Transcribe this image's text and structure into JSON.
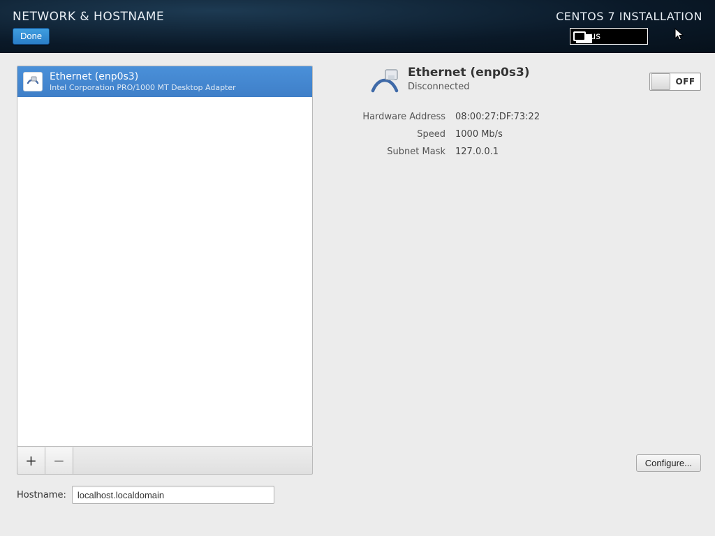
{
  "header": {
    "title": "NETWORK & HOSTNAME",
    "done": "Done",
    "right_title": "CENTOS 7 INSTALLATION",
    "keyboard_layout": "us"
  },
  "devices": [
    {
      "name": "Ethernet (enp0s3)",
      "adapter": "Intel Corporation PRO/1000 MT Desktop Adapter"
    }
  ],
  "toolbar": {
    "add": "+",
    "remove": "−"
  },
  "panel": {
    "title": "Ethernet (enp0s3)",
    "status": "Disconnected",
    "toggle_label": "OFF",
    "rows": {
      "hw_label": "Hardware Address",
      "hw_value": "08:00:27:DF:73:22",
      "speed_label": "Speed",
      "speed_value": "1000 Mb/s",
      "subnet_label": "Subnet Mask",
      "subnet_value": "127.0.0.1"
    },
    "configure": "Configure..."
  },
  "hostname": {
    "label": "Hostname:",
    "value": "localhost.localdomain"
  }
}
